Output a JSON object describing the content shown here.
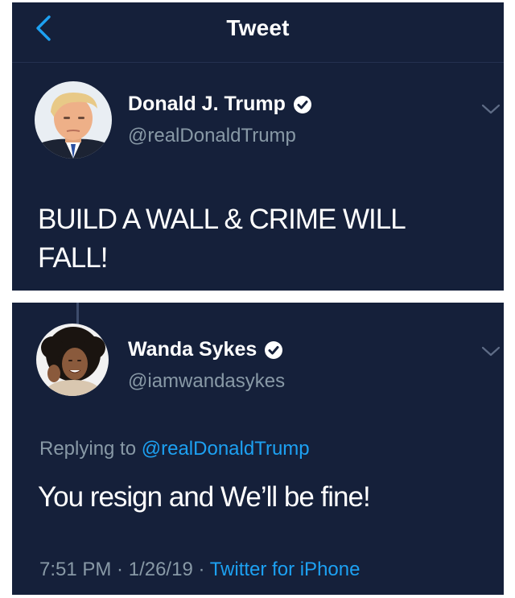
{
  "nav": {
    "title": "Tweet"
  },
  "tweet": {
    "author": {
      "display_name": "Donald J. Trump",
      "handle": "@realDonaldTrump",
      "verified": true
    },
    "text_line1": "BUILD A WALL & CRIME WILL",
    "text_line2": "FALL!"
  },
  "reply": {
    "author": {
      "display_name": "Wanda Sykes",
      "handle": "@iamwandasykes",
      "verified": true
    },
    "replying_prefix": "Replying to ",
    "replying_to": "@realDonaldTrump",
    "text": "You resign and We’ll be fine!",
    "time": "7:51 PM",
    "separator": " · ",
    "date": "1/26/19",
    "source": "Twitter for iPhone"
  },
  "colors": {
    "background": "#15203a",
    "link": "#1da1f2",
    "secondary_text": "#8899a6",
    "primary_text": "#ffffff"
  },
  "icons": [
    "back-chevron-icon",
    "verified-badge-icon",
    "chevron-down-icon"
  ]
}
